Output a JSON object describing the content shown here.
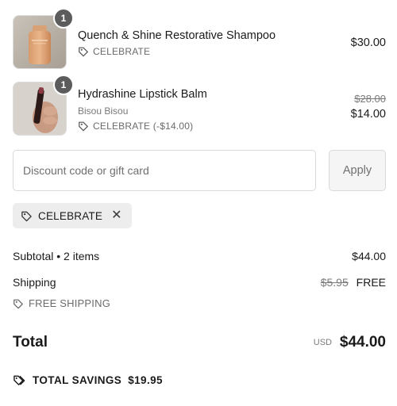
{
  "items": [
    {
      "quantity": "1",
      "name": "Quench & Shine Restorative Shampoo",
      "discount": "CELEBRATE",
      "price": "$30.00",
      "thumb_icon": "shampoo-bottle-image"
    },
    {
      "quantity": "1",
      "name": "Hydrashine Lipstick Balm",
      "vendor": "Bisou Bisou",
      "discount": "CELEBRATE (-$14.00)",
      "original_price": "$28.00",
      "price": "$14.00",
      "thumb_icon": "lipstick-in-hand-image"
    }
  ],
  "discount": {
    "placeholder": "Discount code or gift card",
    "apply_label": "Apply",
    "applied_code": "CELEBRATE"
  },
  "summary": {
    "subtotal_label": "Subtotal • 2 items",
    "subtotal_value": "$44.00",
    "shipping_label": "Shipping",
    "shipping_original": "$5.95",
    "shipping_value": "FREE",
    "shipping_discount": "FREE SHIPPING",
    "total_label": "Total",
    "currency": "USD",
    "total_value": "$44.00",
    "savings_label": "TOTAL SAVINGS",
    "savings_value": "$19.95"
  },
  "colors": {
    "badge": "#5c5c5c",
    "chip_bg": "#ededed",
    "text": "#1a1a1a",
    "muted": "#707070"
  }
}
